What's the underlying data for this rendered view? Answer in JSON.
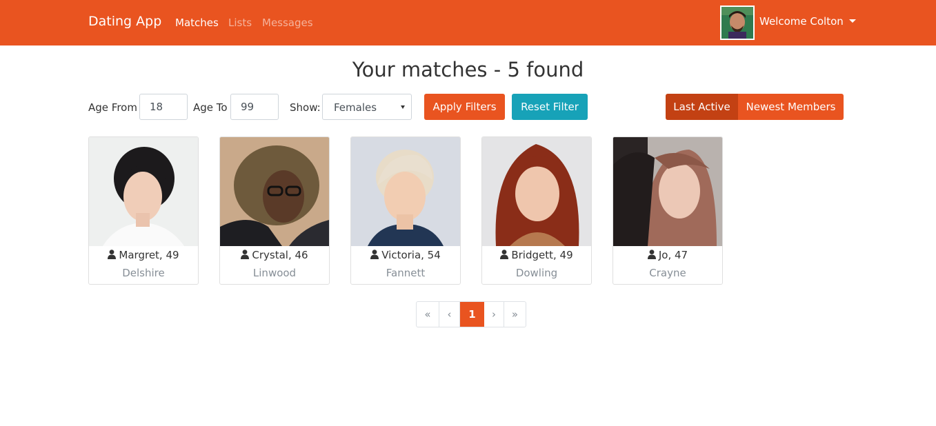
{
  "nav": {
    "brand": "Dating App",
    "links": [
      {
        "label": "Matches",
        "active": true
      },
      {
        "label": "Lists",
        "active": false
      },
      {
        "label": "Messages",
        "active": false
      }
    ],
    "welcome": "Welcome Colton",
    "accent": "#e95420"
  },
  "title": "Your matches - 5 found",
  "filters": {
    "age_from_label": "Age From",
    "age_from_value": "18",
    "age_to_label": "Age To",
    "age_to_value": "99",
    "show_label": "Show:",
    "show_value": "Females",
    "apply_label": "Apply Filters",
    "reset_label": "Reset Filter",
    "sort_options": [
      {
        "label": "Last Active",
        "active": true
      },
      {
        "label": "Newest Members",
        "active": false
      }
    ]
  },
  "members": [
    {
      "name": "Margret, 49",
      "city": "Delshire"
    },
    {
      "name": "Crystal, 46",
      "city": "Linwood"
    },
    {
      "name": "Victoria, 54",
      "city": "Fannett"
    },
    {
      "name": "Bridgett, 49",
      "city": "Dowling"
    },
    {
      "name": "Jo, 47",
      "city": "Crayne"
    }
  ],
  "pagination": {
    "first": "«",
    "prev": "‹",
    "current": "1",
    "next": "›",
    "last": "»"
  },
  "colors": {
    "primary": "#e95420",
    "primary_dark": "#c34113",
    "info": "#17a2b8"
  }
}
